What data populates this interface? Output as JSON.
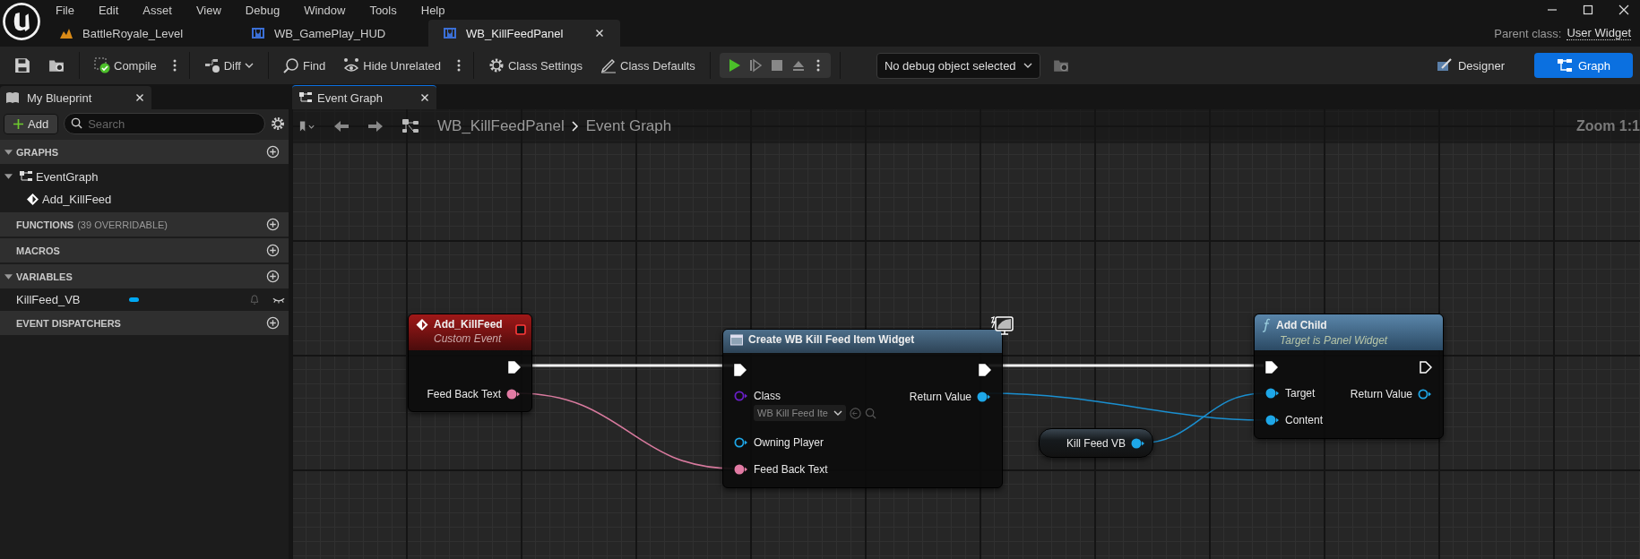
{
  "menu": [
    "File",
    "Edit",
    "Asset",
    "View",
    "Debug",
    "Window",
    "Tools",
    "Help"
  ],
  "document_tabs": [
    {
      "label": "BattleRoyale_Level",
      "kind": "level",
      "selected": false
    },
    {
      "label": "WB_GamePlay_HUD",
      "kind": "widget",
      "selected": false
    },
    {
      "label": "WB_KillFeedPanel",
      "kind": "widget",
      "selected": true
    }
  ],
  "parent_class": {
    "label": "Parent class:",
    "value": "User Widget"
  },
  "toolbar": {
    "compile": "Compile",
    "diff": "Diff",
    "find": "Find",
    "hide_unrelated": "Hide Unrelated",
    "class_settings": "Class Settings",
    "class_defaults": "Class Defaults",
    "debug_object": "No debug object selected"
  },
  "modes": [
    {
      "label": "Designer",
      "kind": "designer",
      "selected": false
    },
    {
      "label": "Graph",
      "kind": "graph",
      "selected": true
    }
  ],
  "my_blueprint": {
    "tab": "My Blueprint",
    "add": "Add",
    "search_placeholder": "Search",
    "sections": [
      {
        "title": "GRAPHS",
        "items": [
          {
            "label": "EventGraph",
            "kind": "graph",
            "expanded": true,
            "children": [
              {
                "label": "Add_KillFeed",
                "kind": "event"
              }
            ]
          }
        ]
      },
      {
        "title": "FUNCTIONS",
        "note": "(39 OVERRIDABLE)"
      },
      {
        "title": "MACROS"
      },
      {
        "title": "VARIABLES",
        "items": [
          {
            "label": "KillFeed_VB",
            "kind": "variable",
            "color": "#00a8f3"
          }
        ]
      },
      {
        "title": "EVENT DISPATCHERS"
      }
    ]
  },
  "graph_tab": {
    "label": "Event Graph"
  },
  "breadcrumb": [
    "WB_KillFeedPanel",
    "Event Graph"
  ],
  "zoom": "Zoom 1:1",
  "nodes": [
    {
      "kind": "event",
      "title": "Add_KillFeed",
      "subtitle": "Custom Event",
      "outputs": [
        {
          "kind": "exec",
          "connected": true
        },
        {
          "kind": "data",
          "label": "Feed Back Text",
          "color": "#e27ba4",
          "connected": true
        }
      ]
    },
    {
      "kind": "create",
      "title": "Create WB Kill Feed Item Widget",
      "inputs": [
        {
          "kind": "exec",
          "connected": true
        },
        {
          "kind": "data",
          "label": "Class",
          "color": "#6a1fc9",
          "connected": false,
          "value": "WB Kill Feed Ite"
        },
        {
          "kind": "data",
          "label": "Owning Player",
          "color": "#1ea7e8",
          "connected": false
        },
        {
          "kind": "data",
          "label": "Feed Back Text",
          "color": "#e27ba4",
          "connected": true
        }
      ],
      "outputs": [
        {
          "kind": "exec",
          "connected": true
        },
        {
          "kind": "data",
          "label": "Return Value",
          "color": "#1ea7e8",
          "connected": true
        }
      ]
    },
    {
      "kind": "function",
      "title": "Add Child",
      "subtitle": "Target is Panel Widget",
      "inputs": [
        {
          "kind": "exec",
          "connected": true
        },
        {
          "kind": "data",
          "label": "Target",
          "color": "#1ea7e8",
          "connected": true
        },
        {
          "kind": "data",
          "label": "Content",
          "color": "#1ea7e8",
          "connected": true
        }
      ],
      "outputs": [
        {
          "kind": "exec",
          "connected": false
        },
        {
          "kind": "data",
          "label": "Return Value",
          "color": "#1ea7e8",
          "connected": false
        }
      ]
    },
    {
      "kind": "variable",
      "title": "Kill Feed VB",
      "outputs": [
        {
          "kind": "data",
          "color": "#1ea7e8",
          "connected": true
        }
      ]
    }
  ]
}
